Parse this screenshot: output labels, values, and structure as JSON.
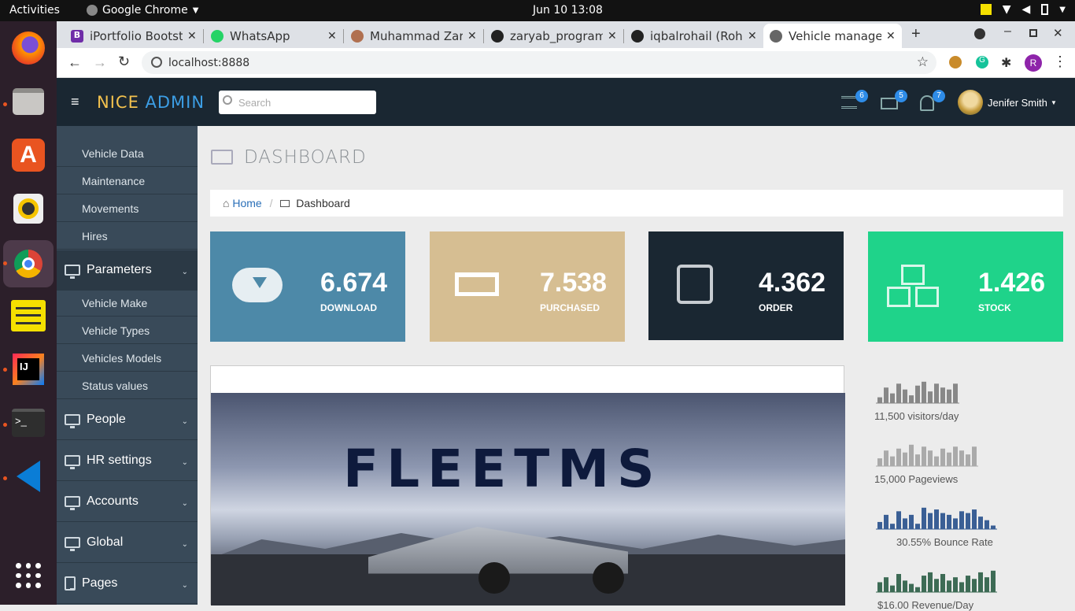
{
  "system": {
    "activities": "Activities",
    "app_name": "Google Chrome",
    "clock": "Jun 10  13:08"
  },
  "tabs": [
    {
      "title": "iPortfolio Bootstr",
      "color": "#6f2da8",
      "letter": "B"
    },
    {
      "title": "WhatsApp",
      "color": "#25d366",
      "letter": ""
    },
    {
      "title": "Muhammad Zary",
      "color": "#b07050",
      "letter": ""
    },
    {
      "title": "zaryab_program",
      "color": "#222",
      "letter": ""
    },
    {
      "title": "iqbalrohail (Roha",
      "color": "#222",
      "letter": ""
    },
    {
      "title": "Vehicle managen",
      "color": "#666",
      "letter": ""
    }
  ],
  "address": {
    "url": "localhost:8888",
    "profile": "R"
  },
  "header": {
    "logo_a": "NICE ",
    "logo_b": "ADMIN",
    "search_placeholder": "Search",
    "badge_tasks": "6",
    "badge_mail": "5",
    "badge_bell": "7",
    "user": "Jenifer Smith"
  },
  "sidebar": {
    "sub_top": [
      "Vehicle Data",
      "Maintenance",
      "Movements",
      "Hires"
    ],
    "parameters": "Parameters",
    "sub_params": [
      "Vehicle Make",
      "Vehicle Types",
      "Vehicles Models",
      "Status values"
    ],
    "groups": [
      "People",
      "HR settings",
      "Accounts",
      "Global",
      "Pages"
    ]
  },
  "page": {
    "title": "DASHBOARD",
    "crumb_home": "Home",
    "crumb_current": "Dashboard"
  },
  "cards": [
    {
      "value": "6.674",
      "label": "DOWNLOAD",
      "color": "#4d89a8"
    },
    {
      "value": "7.538",
      "label": "PURCHASED",
      "color": "#d6be92"
    },
    {
      "value": "4.362",
      "label": "ORDER",
      "color": "#1a2732"
    },
    {
      "value": "1.426",
      "label": "STOCK",
      "color": "#1fd38a"
    }
  ],
  "banner": {
    "text": "FLEETMS"
  },
  "stats": [
    {
      "label": "11,500 visitors/day",
      "color": "#888",
      "values": [
        3,
        8,
        5,
        10,
        7,
        4,
        9,
        11,
        6,
        10,
        8,
        7,
        10
      ]
    },
    {
      "label": "15,000 Pageviews",
      "color": "#aaa",
      "values": [
        4,
        8,
        5,
        9,
        7,
        11,
        6,
        10,
        8,
        5,
        9,
        7,
        10,
        8,
        6,
        10
      ]
    },
    {
      "label": "30.55% Bounce Rate",
      "color": "#3a5f95",
      "values": [
        4,
        8,
        3,
        10,
        6,
        8,
        3,
        12,
        9,
        11,
        9,
        8,
        6,
        10,
        9,
        11,
        7,
        5,
        2
      ]
    },
    {
      "label": "$16.00 Revenue/Day",
      "color": "#3d6b55",
      "values": [
        6,
        9,
        4,
        11,
        7,
        5,
        3,
        10,
        12,
        8,
        11,
        7,
        9,
        6,
        10,
        8,
        12,
        9,
        13
      ]
    }
  ]
}
